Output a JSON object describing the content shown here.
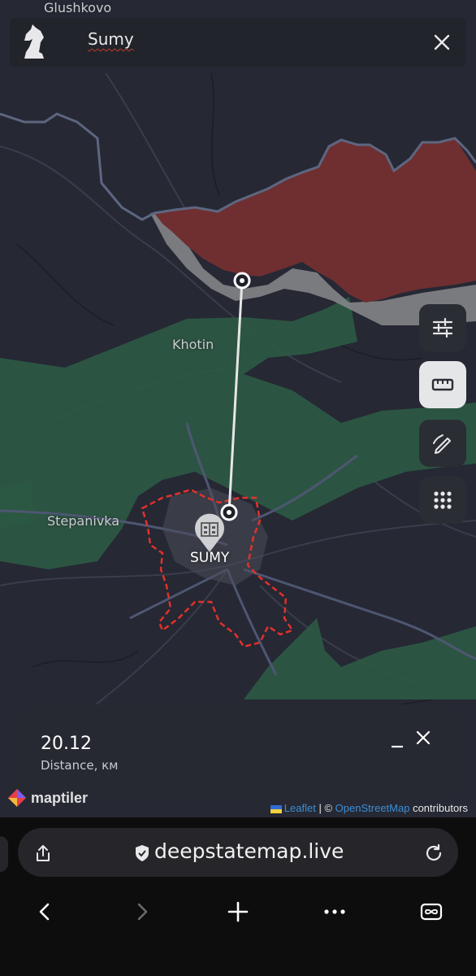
{
  "search": {
    "value": "Sumy"
  },
  "map": {
    "labels": {
      "glushkovo": "Glushkovo",
      "khotin": "Khotin",
      "stepanivka": "Stepanivka",
      "city": "SUMY"
    },
    "colors": {
      "background": "#262834",
      "occupied": "#6f2f30",
      "grey_zone": "#8a8a8d",
      "green_zone": "#2c5a44",
      "border": "#5d6680",
      "city_outline": "#e0322b",
      "measure_line": "#e6e6e6"
    }
  },
  "controls": [
    {
      "name": "filters-icon",
      "active": false
    },
    {
      "name": "ruler-icon",
      "active": true
    },
    {
      "name": "draw-icon",
      "active": false
    },
    {
      "name": "grid-icon",
      "active": false
    }
  ],
  "distance": {
    "value": "20.12",
    "label": "Distance, км",
    "minimize": "_"
  },
  "attribution": {
    "maptiler": "maptiler",
    "leaflet": "Leaflet",
    "separator": "| ©",
    "osm": "OpenStreetMap",
    "suffix": "contributors"
  },
  "browser": {
    "url": "deepstatemap.live"
  }
}
